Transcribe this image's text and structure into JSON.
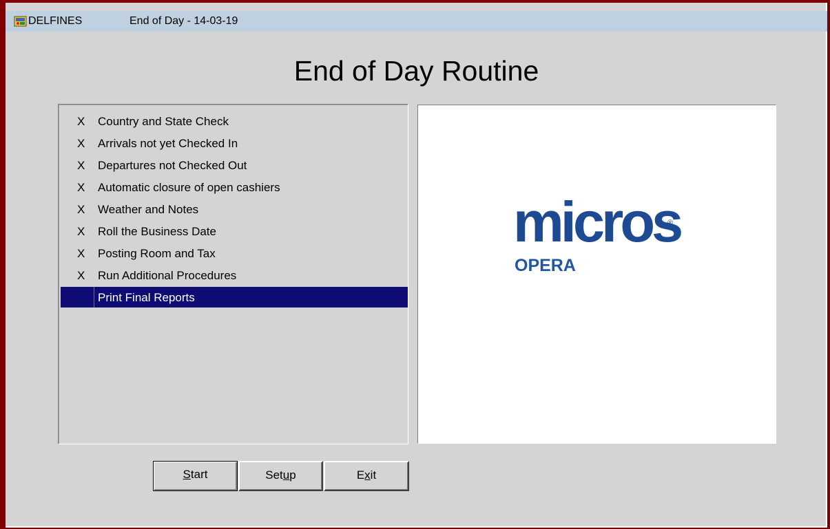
{
  "window": {
    "app_name": "DELFINES",
    "title": "End of Day - 14-03-19",
    "icon": "app-icon"
  },
  "page_title": "End of Day Routine",
  "steps": [
    {
      "status": "X",
      "label": "Country and State Check",
      "selected": false
    },
    {
      "status": "X",
      "label": "Arrivals not yet Checked In",
      "selected": false
    },
    {
      "status": "X",
      "label": "Departures not Checked Out",
      "selected": false
    },
    {
      "status": "X",
      "label": "Automatic closure of open cashiers",
      "selected": false
    },
    {
      "status": "X",
      "label": "Weather and Notes",
      "selected": false
    },
    {
      "status": "X",
      "label": "Roll the Business Date",
      "selected": false
    },
    {
      "status": "X",
      "label": "Posting Room and Tax",
      "selected": false
    },
    {
      "status": "X",
      "label": "Run Additional Procedures",
      "selected": false
    },
    {
      "status": "",
      "label": "Print Final Reports",
      "selected": true
    }
  ],
  "logo": {
    "brand": "micros",
    "registered": "®",
    "product": "OPERA",
    "color": "#1d4a92"
  },
  "buttons": {
    "start": {
      "pre": "",
      "mnemonic": "S",
      "post": "tart"
    },
    "setup": {
      "pre": "Set",
      "mnemonic": "u",
      "post": "p"
    },
    "exit": {
      "pre": "E",
      "mnemonic": "x",
      "post": "it"
    }
  },
  "colors": {
    "frame": "#800000",
    "title_bar": "#bfd1e1",
    "selection": "#0c0c74",
    "background": "#d4d4d4"
  }
}
